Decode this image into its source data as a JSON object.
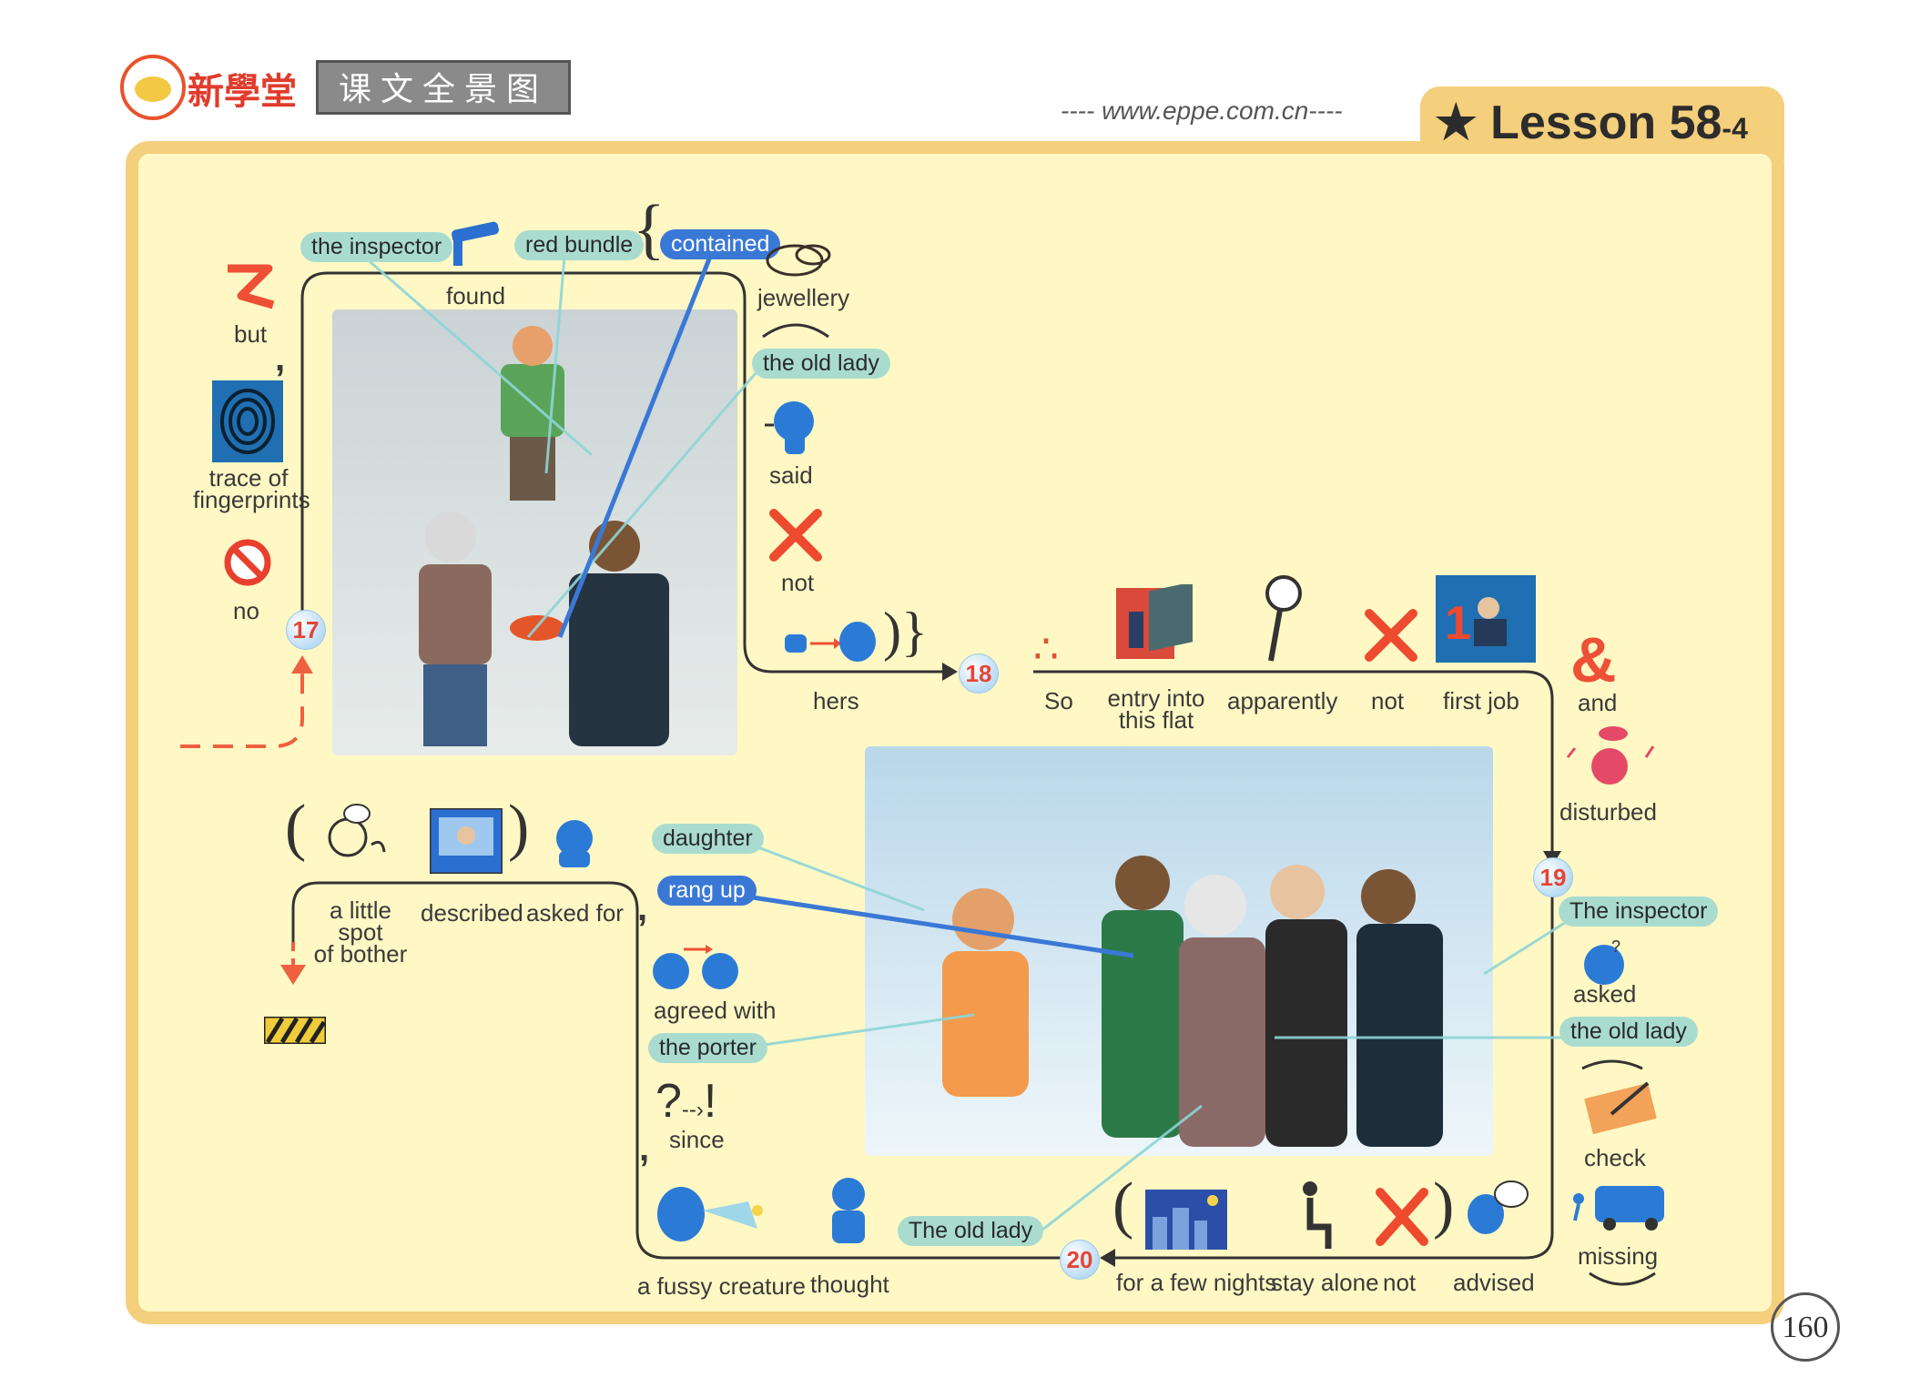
{
  "header": {
    "brand": "新學堂",
    "section_title": "课文全景图",
    "url": "---- www.eppe.com.cn----",
    "lesson": "Lesson 58",
    "lesson_sub": "-4",
    "page_number": "160"
  },
  "colors": {
    "panel": "#fff8c4",
    "border": "#f4cf7c",
    "pill": "#a9dccf",
    "pill_blue": "#3a78d6",
    "number": "#e54535"
  },
  "nodes": {
    "n17": "17",
    "n18": "18",
    "n19": "19",
    "n20": "20"
  },
  "top_left": {
    "but": "but",
    "trace": "trace of\nfingerprints",
    "no": "no",
    "the_inspector": "the inspector",
    "found": "found",
    "red_bundle": "red bundle",
    "contained": "contained",
    "jewellery": "jewellery",
    "the_old_lady": "the old lady",
    "said": "said",
    "not": "not",
    "hers": "hers"
  },
  "row18": {
    "so": "So",
    "entry": "entry into\nthis flat",
    "apparently": "apparently",
    "not": "not",
    "first_job": "first job",
    "and": "and",
    "disturbed": "disturbed"
  },
  "right_col": {
    "the_inspector": "The inspector",
    "asked": "asked",
    "the_old_lady": "the old lady",
    "check": "check",
    "missing": "missing"
  },
  "row20": {
    "for_a_few_nights": "for a few nights",
    "stay_alone": "stay alone",
    "not": "not",
    "advised": "advised",
    "the_old_lady": "The old lady",
    "thought": "thought",
    "a_fussy_creature": "a fussy creature"
  },
  "middle_left": {
    "daughter": "daughter",
    "rang_up": "rang up",
    "agreed_with": "agreed with",
    "the_porter": "the porter",
    "since": "since",
    "a_little_spot": "a little spot\nof bother",
    "described": "described",
    "asked_for": "asked for"
  }
}
